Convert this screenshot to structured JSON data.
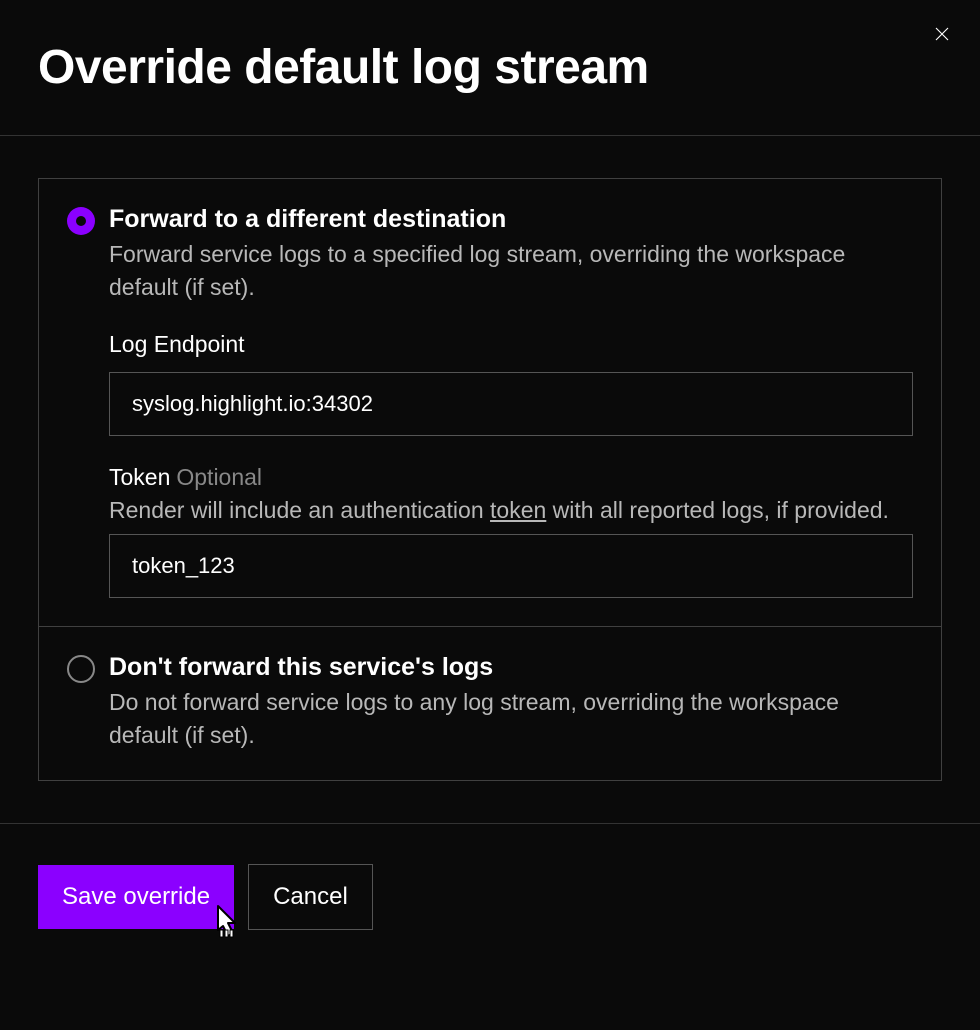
{
  "dialog": {
    "title": "Override default log stream"
  },
  "options": {
    "forward": {
      "title": "Forward to a different destination",
      "description": "Forward service logs to a specified log stream, overriding the workspace default (if set).",
      "endpoint_label": "Log Endpoint",
      "endpoint_value": "syslog.highlight.io:34302",
      "token_label": "Token",
      "token_suffix": "Optional",
      "token_help_pre": "Render will include an authentication ",
      "token_help_link": "token",
      "token_help_post": " with all reported logs, if provided.",
      "token_value": "token_123"
    },
    "dont_forward": {
      "title": "Don't forward this service's logs",
      "description": "Do not forward service logs to any log stream, overriding the workspace default (if set)."
    }
  },
  "footer": {
    "save_label": "Save override",
    "cancel_label": "Cancel"
  }
}
